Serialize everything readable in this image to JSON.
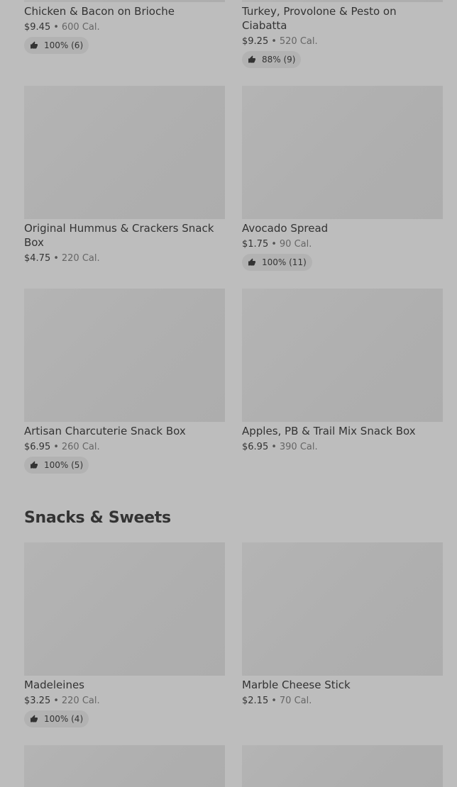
{
  "items_top": [
    {
      "name": "Chicken & Bacon on Brioche",
      "price": "$9.45",
      "cal": "600 Cal.",
      "rating": "100% (6)"
    },
    {
      "name": "Turkey, Provolone & Pesto on Ciabatta",
      "price": "$9.25",
      "cal": "520 Cal.",
      "rating": "88% (9)"
    }
  ],
  "items_row2": [
    {
      "name": "Original Hummus & Crackers Snack Box",
      "price": "$4.75",
      "cal": "220 Cal."
    },
    {
      "name": "Avocado Spread",
      "price": "$1.75",
      "cal": "90 Cal.",
      "rating": "100% (11)"
    }
  ],
  "items_row3": [
    {
      "name": "Artisan Charcuterie Snack Box",
      "price": "$6.95",
      "cal": "260 Cal.",
      "rating": "100% (5)"
    },
    {
      "name": "Apples, PB & Trail Mix Snack Box",
      "price": "$6.95",
      "cal": "390 Cal."
    }
  ],
  "section": {
    "title": "Snacks & Sweets"
  },
  "items_row4": [
    {
      "name": "Madeleines",
      "price": "$3.25",
      "cal": "220 Cal.",
      "rating": "100% (4)"
    },
    {
      "name": "Marble Cheese Stick",
      "price": "$2.15",
      "cal": "70 Cal."
    }
  ],
  "separator": "•",
  "icons": {
    "rating": "thumbs-up-icon"
  }
}
